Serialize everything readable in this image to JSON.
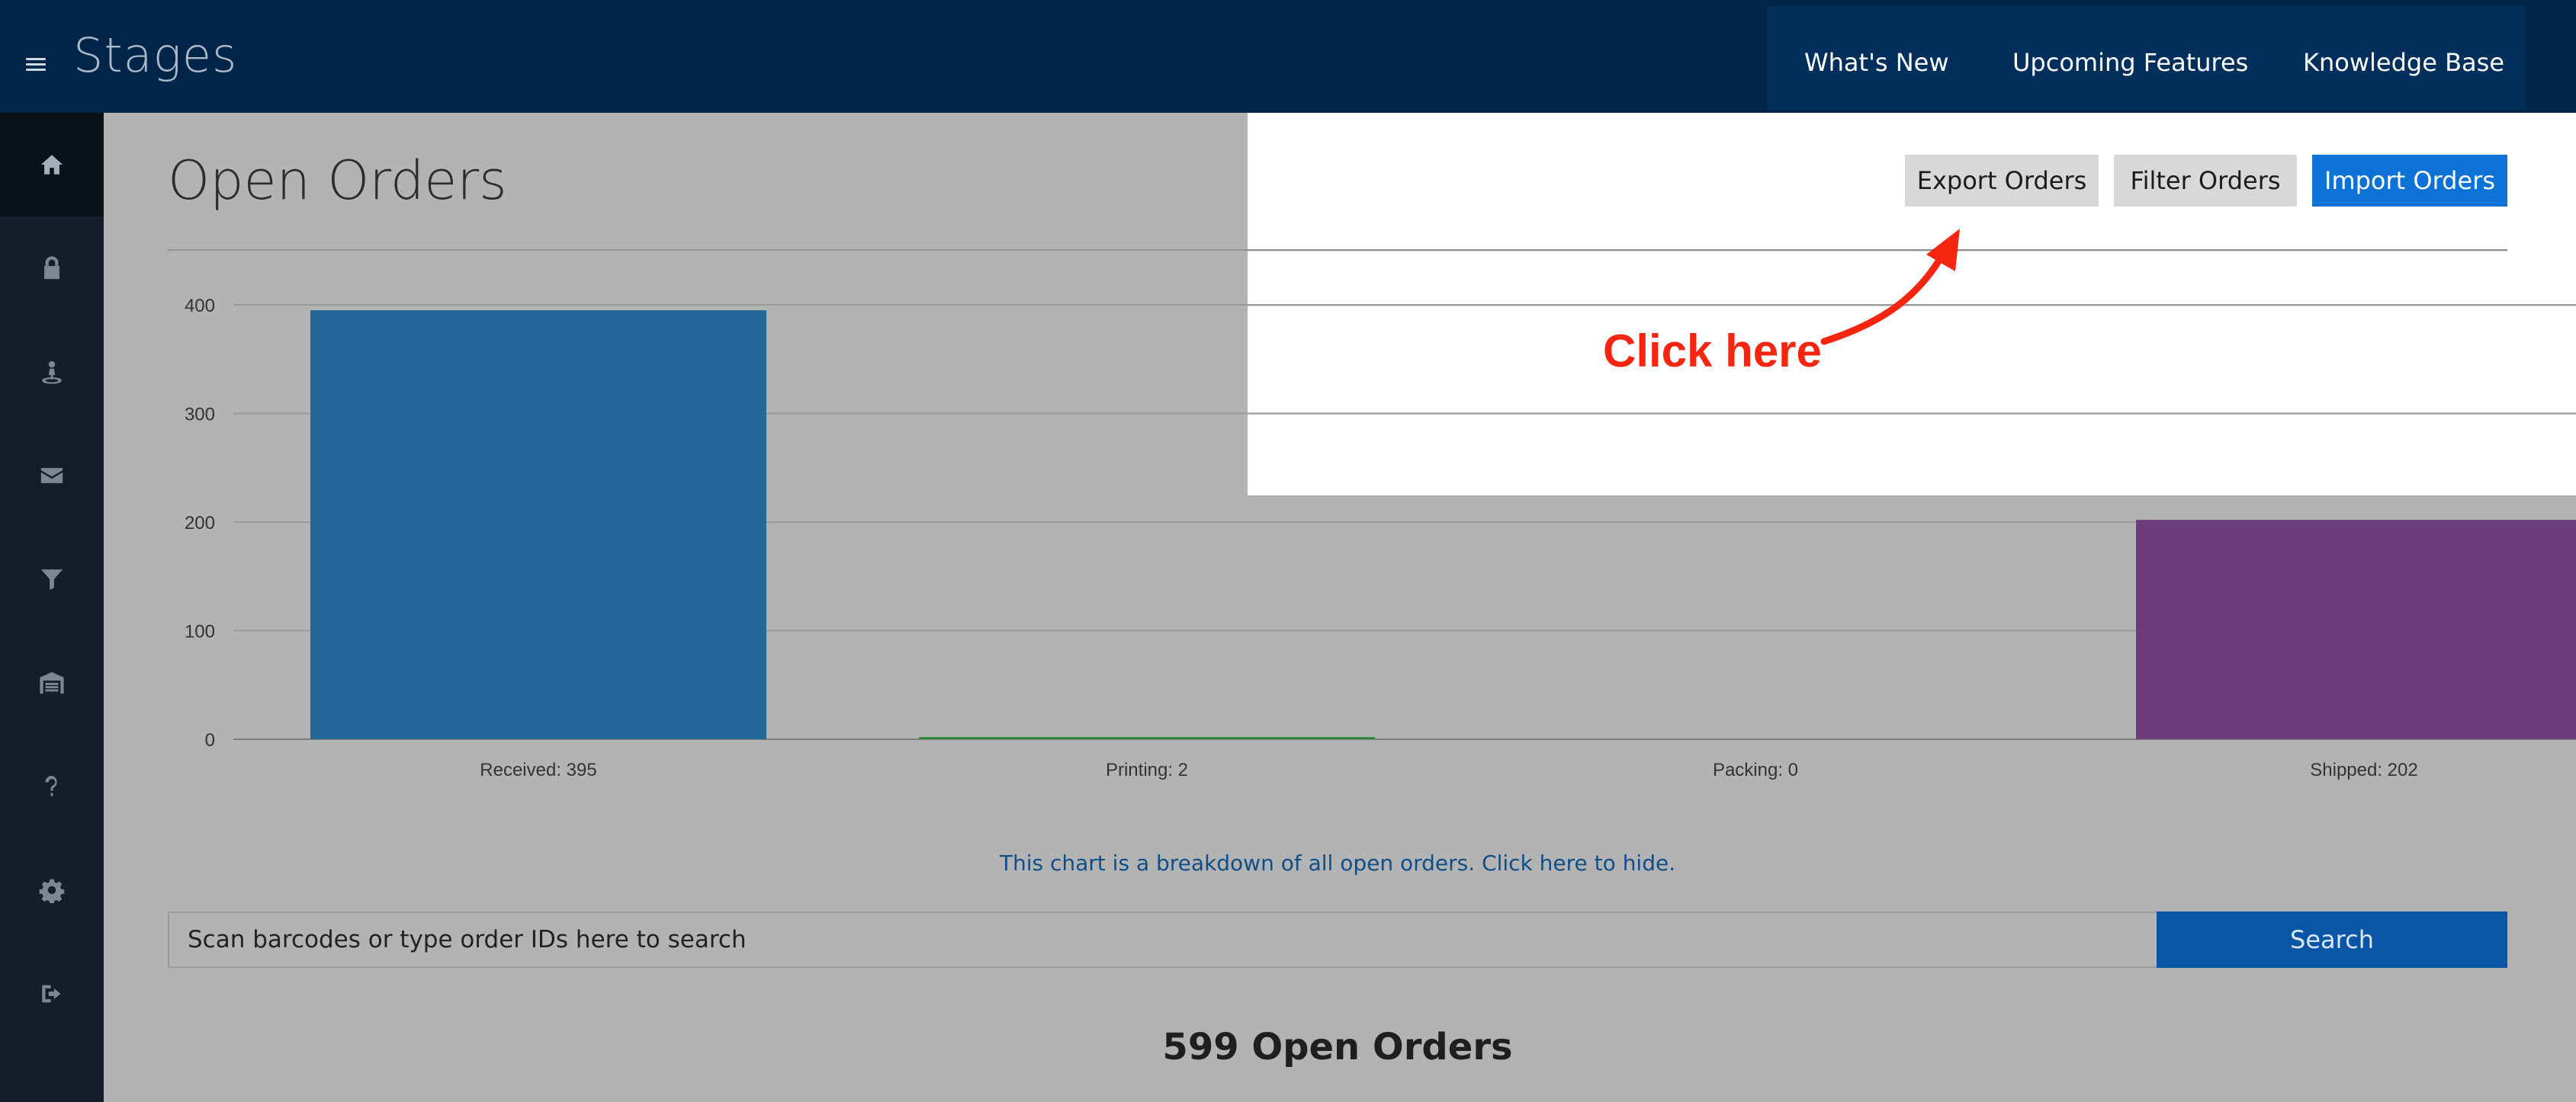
{
  "header": {
    "brand": "Stages",
    "nav": [
      "What's New",
      "Upcoming Features",
      "Knowledge Base"
    ]
  },
  "sidebar": {
    "items": [
      {
        "icon": "home-icon"
      },
      {
        "icon": "lock-icon"
      },
      {
        "icon": "user-pin-icon"
      },
      {
        "icon": "envelope-icon"
      },
      {
        "icon": "filter-icon"
      },
      {
        "icon": "warehouse-icon"
      },
      {
        "icon": "question-icon"
      },
      {
        "icon": "gear-icon"
      },
      {
        "icon": "sign-out-icon"
      }
    ]
  },
  "main": {
    "title": "Open Orders",
    "buttons": {
      "export": "Export Orders",
      "filter": "Filter Orders",
      "import": "Import Orders"
    },
    "hint": "Click here",
    "chart_note": "This chart is a breakdown of all open orders. Click here to hide.",
    "search": {
      "placeholder": "Scan barcodes or type order IDs here to search",
      "button": "Search"
    },
    "count": "599 Open Orders"
  },
  "colors": {
    "received": "#236899",
    "printing": "#2e8b3a",
    "packing": "#c96a1a",
    "shipped": "#6b3b7c",
    "accent": "#0c72d6"
  },
  "chart_data": {
    "type": "bar",
    "categories": [
      "Received: 395",
      "Printing: 2",
      "Packing: 0",
      "Shipped: 202"
    ],
    "values": [
      395,
      2,
      0,
      202
    ],
    "yticks": [
      0,
      100,
      200,
      300,
      400
    ],
    "ylim": [
      0,
      400
    ],
    "grid": true
  }
}
